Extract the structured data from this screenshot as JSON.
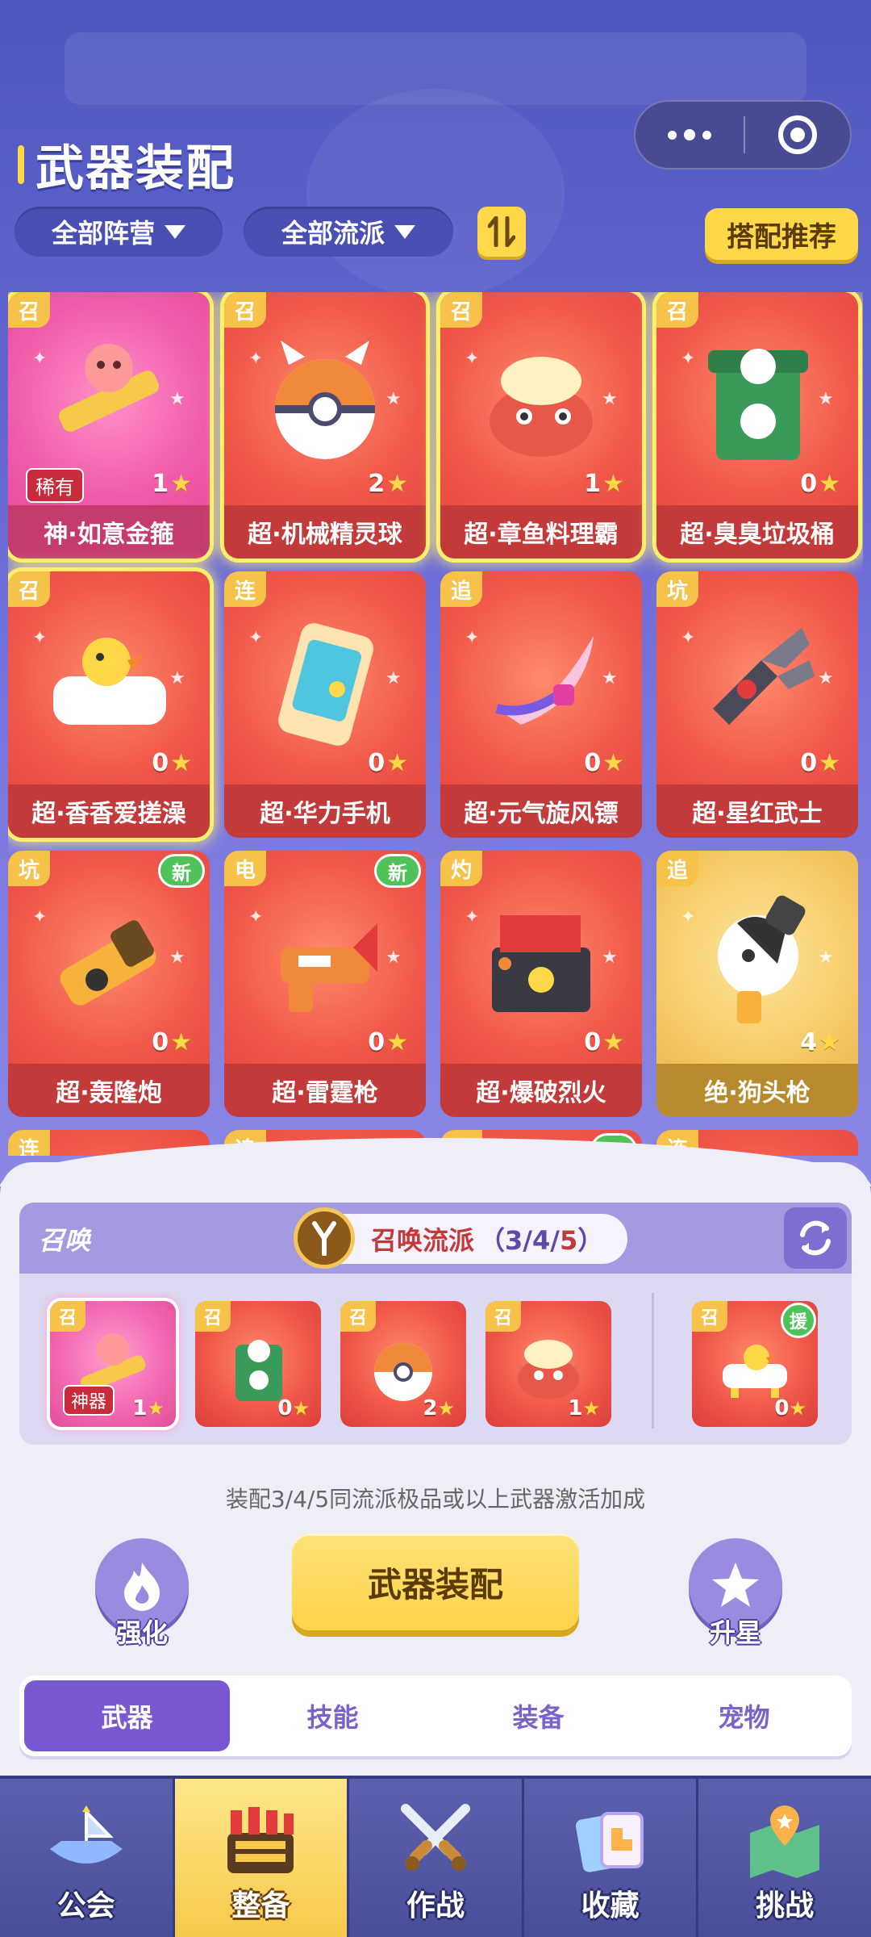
{
  "header": {
    "title": "武器装配"
  },
  "filters": {
    "camp": "全部阵营",
    "school": "全部流派",
    "sort_icon": "sort-icon",
    "recommend": "搭配推荐"
  },
  "weapons": [
    {
      "tag": "召",
      "name": "神·如意金箍",
      "count": "1",
      "rare": "稀有",
      "style": "pink",
      "selected": true
    },
    {
      "tag": "召",
      "name": "超·机械精灵球",
      "count": "2",
      "style": "red",
      "selected": true
    },
    {
      "tag": "召",
      "name": "超·章鱼料理霸",
      "count": "1",
      "style": "red",
      "selected": true
    },
    {
      "tag": "召",
      "name": "超·臭臭垃圾桶",
      "count": "0",
      "style": "red",
      "selected": true
    },
    {
      "tag": "召",
      "name": "超·香香爱搓澡",
      "count": "0",
      "style": "red",
      "selected": true
    },
    {
      "tag": "连",
      "name": "超·华力手机",
      "count": "0",
      "style": "red"
    },
    {
      "tag": "追",
      "name": "超·元气旋风镖",
      "count": "0",
      "style": "red"
    },
    {
      "tag": "坑",
      "name": "超·星红武士",
      "count": "0",
      "style": "red"
    },
    {
      "tag": "坑",
      "name": "超·轰隆炮",
      "count": "0",
      "style": "red",
      "new": "新"
    },
    {
      "tag": "电",
      "name": "超·雷霆枪",
      "count": "0",
      "style": "red",
      "new": "新"
    },
    {
      "tag": "灼",
      "name": "超·爆破烈火",
      "count": "0",
      "style": "red"
    },
    {
      "tag": "追",
      "name": "绝·狗头枪",
      "count": "4",
      "style": "gold"
    },
    {
      "tag": "连",
      "name": "",
      "count": "",
      "style": "red"
    },
    {
      "tag": "追",
      "name": "",
      "count": "",
      "style": "red"
    },
    {
      "tag": "连",
      "name": "",
      "count": "",
      "style": "red",
      "new": "新"
    },
    {
      "tag": "连",
      "name": "",
      "count": "",
      "style": "red"
    }
  ],
  "faction": {
    "label": "召唤",
    "school": "召唤流派",
    "progress_open": "（",
    "progress_34": "3/4/",
    "progress_5": "5",
    "progress_close": "）"
  },
  "equipped": [
    {
      "tag": "召",
      "count": "1",
      "rare": "神器",
      "style": "pink"
    },
    {
      "tag": "召",
      "count": "0",
      "style": "red"
    },
    {
      "tag": "召",
      "count": "2",
      "style": "red"
    },
    {
      "tag": "召",
      "count": "1",
      "style": "red"
    }
  ],
  "assist": {
    "tag": "召",
    "count": "0",
    "help": "援"
  },
  "hint": "装配3/4/5同流派极品或以上武器激活加成",
  "actions": {
    "strengthen": "强化",
    "equip": "武器装配",
    "star_up": "升星"
  },
  "tabs": [
    "武器",
    "技能",
    "装备",
    "宠物"
  ],
  "nav": [
    "公会",
    "整备",
    "作战",
    "收藏",
    "挑战"
  ]
}
